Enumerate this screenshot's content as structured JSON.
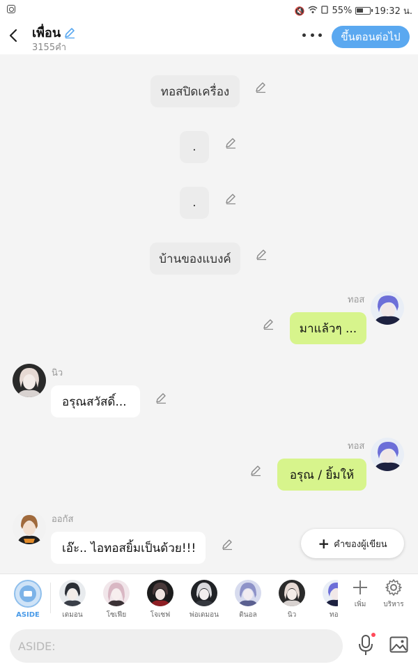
{
  "status_bar": {
    "battery": "55%",
    "time": "19:32 น."
  },
  "header": {
    "title": "เพื่อน",
    "subtitle": "3155คำ",
    "next_label": "ขึ้นตอนต่อไป"
  },
  "messages": [
    {
      "type": "narration",
      "text": "ทอสปิดเครื่อง"
    },
    {
      "type": "narration",
      "text": "."
    },
    {
      "type": "narration",
      "text": "."
    },
    {
      "type": "narration",
      "text": "บ้านของแบงค์"
    },
    {
      "type": "right",
      "speaker": "ทอส",
      "text": "มาแล้วๆ ..."
    },
    {
      "type": "left",
      "speaker": "นิว",
      "text": "อรุณสวัสดิ์..."
    },
    {
      "type": "right",
      "speaker": "ทอส",
      "text": "อรุณ / ยิ้มให้"
    },
    {
      "type": "left",
      "speaker": "ออกัส",
      "text": "เอ๊ะ.. ไอทอสยิ้มเป็นด้วย!!!"
    }
  ],
  "fab": {
    "label": "คำของผู้เขียน"
  },
  "characters": {
    "aside": "ASIDE",
    "items": [
      "เดมอน",
      "โซเฟีย",
      "โจเซฟ",
      "พ่อเดมอน",
      "ดินอล",
      "นิว",
      "ทอ"
    ]
  },
  "tools": {
    "add": "เพิ่ม",
    "manage": "บริหาร"
  },
  "input": {
    "placeholder": "ASIDE:"
  },
  "colors": {
    "accent": "#5aa8f0",
    "right_bubble": "#d7f48c",
    "narration_bubble": "#ececec",
    "mic_dot": "#ff4a5a"
  }
}
